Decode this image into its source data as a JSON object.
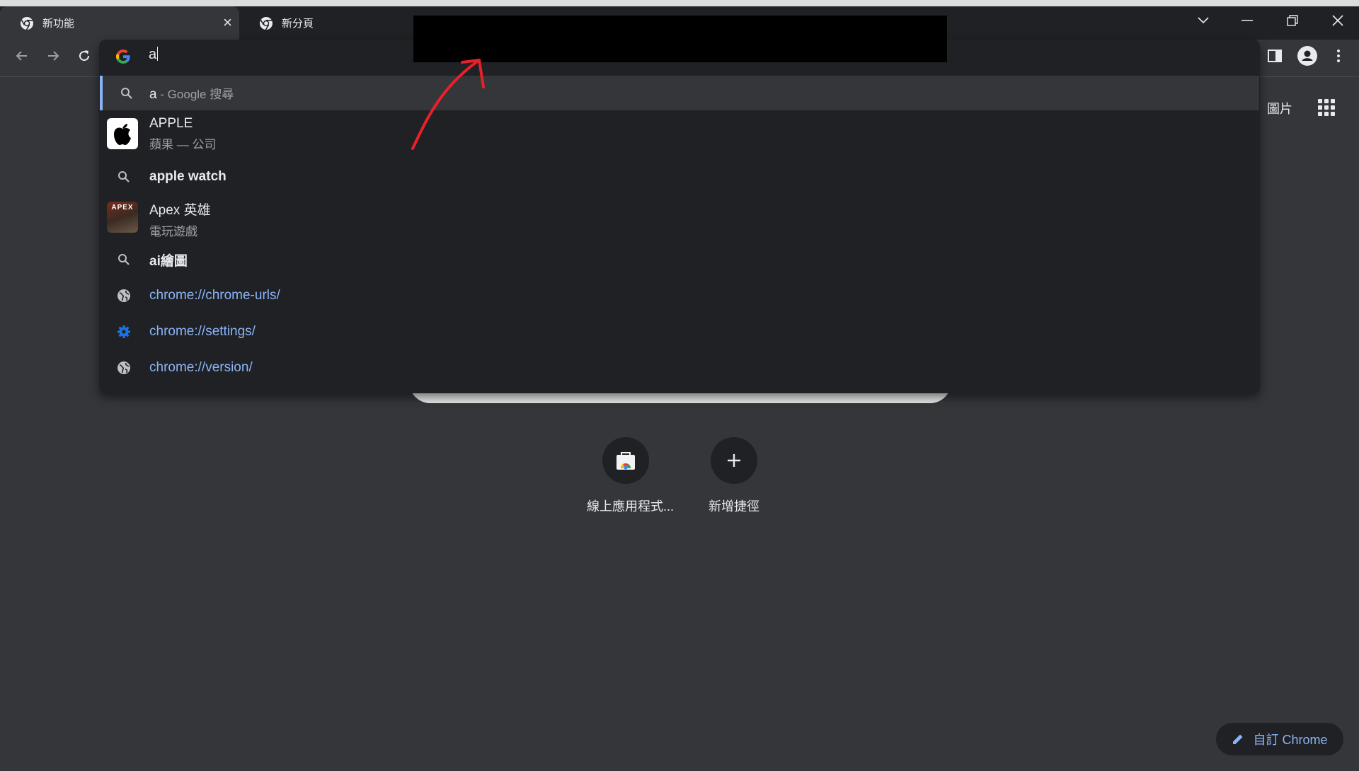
{
  "tabs": [
    {
      "title": "新功能",
      "close_icon": "×"
    },
    {
      "title": "新分頁"
    }
  ],
  "omnibox": {
    "value": "a"
  },
  "suggestions": [
    {
      "kind": "search",
      "main": "a",
      "sub": " - Google 搜尋",
      "icon": "search-icon"
    },
    {
      "kind": "entity",
      "main": "APPLE",
      "sub": "蘋果 — 公司",
      "icon": "apple-logo"
    },
    {
      "kind": "search",
      "main": "apple watch",
      "icon": "search-icon"
    },
    {
      "kind": "entity",
      "main": "Apex 英雄",
      "sub": "電玩遊戲",
      "icon": "apex-thumbnail"
    },
    {
      "kind": "search",
      "main": "ai繪圖",
      "icon": "search-icon"
    },
    {
      "kind": "url",
      "main": "chrome://chrome-urls/",
      "icon": "globe-icon"
    },
    {
      "kind": "url",
      "main": "chrome://settings/",
      "icon": "gear-icon"
    },
    {
      "kind": "url",
      "main": "chrome://version/",
      "icon": "globe-icon"
    }
  ],
  "apex_thumb_text": "APEX",
  "header_links": {
    "images": "圖片"
  },
  "shortcuts": [
    {
      "label": "線上應用程式...",
      "icon": "web-store-icon"
    },
    {
      "label": "新增捷徑",
      "icon": "plus-icon"
    }
  ],
  "customize": {
    "label": "自訂 Chrome"
  },
  "colors": {
    "background": "#35363a",
    "dropdown": "#202124",
    "link": "#8ab4f8",
    "annotation_arrow": "#e8202a"
  }
}
